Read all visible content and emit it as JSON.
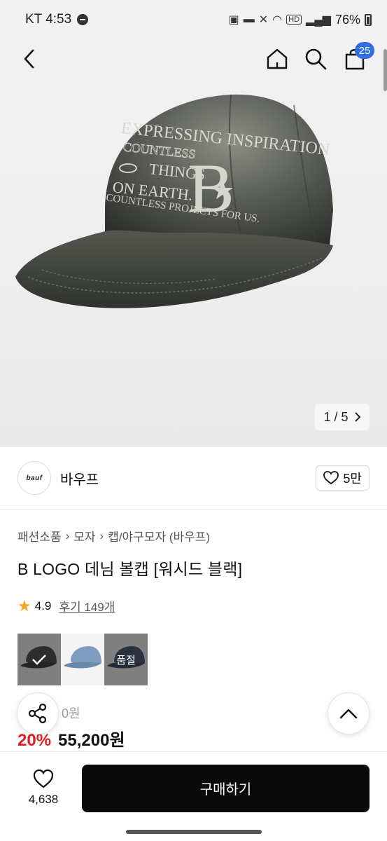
{
  "status_bar": {
    "carrier_time": "KT 4:53",
    "network_label": "HD",
    "battery": "76%"
  },
  "nav": {
    "cart_count": "25"
  },
  "hero": {
    "counter": "1 / 5",
    "cap_text": {
      "line1": "EXPRESSING INSPIRATION",
      "line2": "COUNTLESS",
      "line3": "THINGS",
      "line4": "ON EARTH.",
      "line5": "COUNTLESS PROJECTS FOR US.",
      "logo_letter": "B"
    }
  },
  "brand": {
    "logo_text": "bauf",
    "name": "바우프",
    "likes": "5만"
  },
  "breadcrumb": [
    "패션소품",
    "모자",
    "캡/야구모자 (바우프)"
  ],
  "product": {
    "title": "B LOGO 데님 볼캡 [워시드 블랙]",
    "rating": "4.9",
    "reviews": "후기 149개",
    "options": [
      {
        "color": "#3a3a3a",
        "selected": true,
        "overlay": ""
      },
      {
        "color": "#7d9cbf",
        "selected": false,
        "overlay": ""
      },
      {
        "color": "#2c3e5a",
        "selected": false,
        "overlay": "품절"
      }
    ],
    "original_price_partial": "0원",
    "discount": "20%",
    "sale_price": "55,200원"
  },
  "bottom": {
    "wish_count": "4,638",
    "buy_label": "구매하기"
  },
  "colors": {
    "badge": "#2f6fe0",
    "discount": "#e02020",
    "star": "#f5a623",
    "buy_button": "#0a0a0a"
  },
  "icons": [
    "back-arrow-icon",
    "home-icon",
    "search-icon",
    "shopping-bag-icon",
    "chevron-right-icon",
    "heart-icon",
    "star-icon",
    "check-icon",
    "share-icon",
    "chevron-up-icon"
  ]
}
